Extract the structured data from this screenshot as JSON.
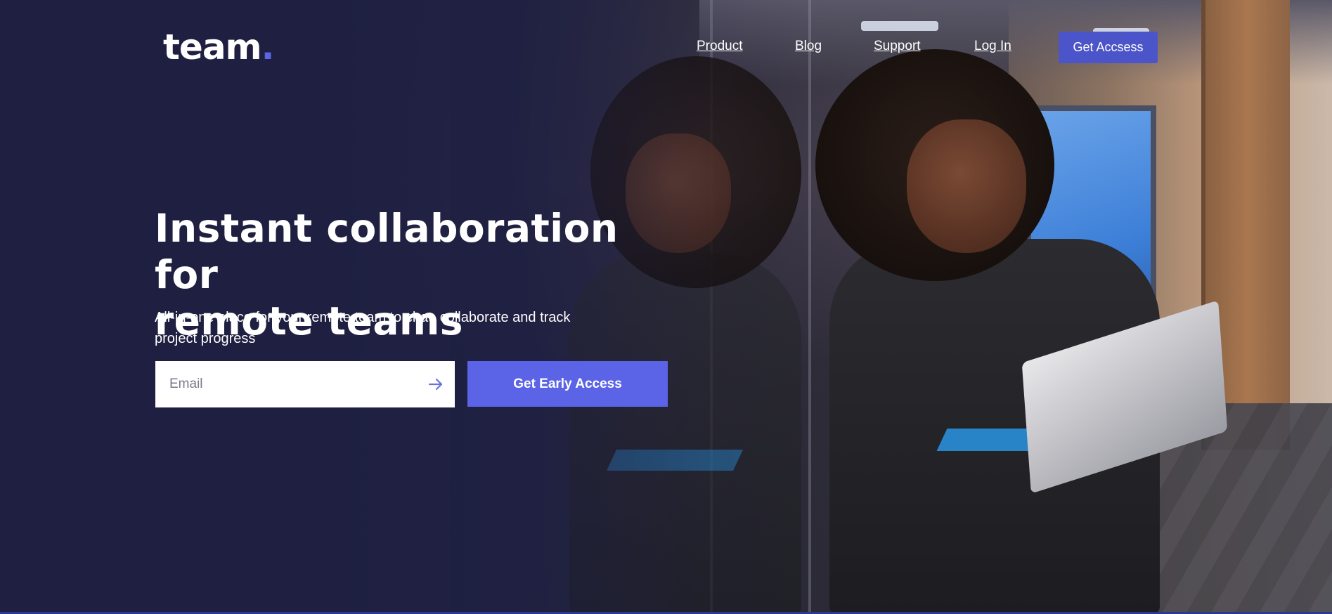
{
  "brand": {
    "logo_text": "team",
    "logo_dot": ".",
    "accent_color": "#5b63e6"
  },
  "nav": {
    "links": [
      {
        "label": "Product"
      },
      {
        "label": "Blog"
      },
      {
        "label": "Support"
      },
      {
        "label": "Log In"
      }
    ],
    "cta_label": "Get Accsess"
  },
  "hero": {
    "title_line1": "Instant collaboration for",
    "title_line2": "remote teams",
    "subtitle_line1": "All-in-one place for your remote team to chat, collaborate and track",
    "subtitle_line2": "project progress",
    "email_placeholder": "Email",
    "email_value": "",
    "arrow_icon": "arrow-right-icon",
    "cta_label": "Get Early Access"
  },
  "background": {
    "image": "woman-with-laptop-photo",
    "overlay_color": "#1e1f41"
  }
}
